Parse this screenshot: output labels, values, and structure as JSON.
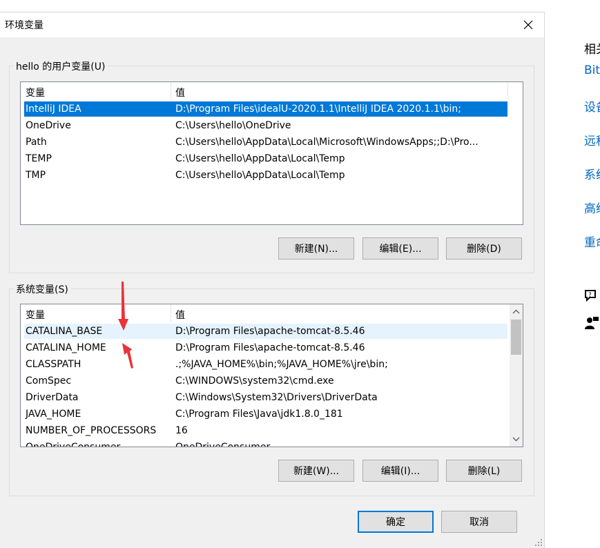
{
  "dialog": {
    "title": "环境变量",
    "close_label": "✕"
  },
  "user_vars": {
    "group_label": "hello 的用户变量(U)",
    "columns": [
      "变量",
      "值"
    ],
    "rows": [
      {
        "name": "IntelliJ IDEA",
        "value": "D:\\Program Files\\idealU-2020.1.1\\IntelliJ IDEA 2020.1.1\\bin;"
      },
      {
        "name": "OneDrive",
        "value": "C:\\Users\\hello\\OneDrive"
      },
      {
        "name": "Path",
        "value": "C:\\Users\\hello\\AppData\\Local\\Microsoft\\WindowsApps;;D:\\Pro..."
      },
      {
        "name": "TEMP",
        "value": "C:\\Users\\hello\\AppData\\Local\\Temp"
      },
      {
        "name": "TMP",
        "value": "C:\\Users\\hello\\AppData\\Local\\Temp"
      }
    ],
    "selected_index": 0,
    "buttons": {
      "new": "新建(N)...",
      "edit": "编辑(E)...",
      "delete": "删除(D)"
    }
  },
  "system_vars": {
    "group_label": "系统变量(S)",
    "columns": [
      "变量",
      "值"
    ],
    "rows": [
      {
        "name": "CATALINA_BASE",
        "value": "D:\\Program Files\\apache-tomcat-8.5.46"
      },
      {
        "name": "CATALINA_HOME",
        "value": "D:\\Program Files\\apache-tomcat-8.5.46"
      },
      {
        "name": "CLASSPATH",
        "value": ".;%JAVA_HOME%\\bin;%JAVA_HOME%\\jre\\bin;"
      },
      {
        "name": "ComSpec",
        "value": "C:\\WINDOWS\\system32\\cmd.exe"
      },
      {
        "name": "DriverData",
        "value": "C:\\Windows\\System32\\Drivers\\DriverData"
      },
      {
        "name": "JAVA_HOME",
        "value": "C:\\Program Files\\Java\\jdk1.8.0_181"
      },
      {
        "name": "NUMBER_OF_PROCESSORS",
        "value": "16"
      },
      {
        "name": "OneDriveConsumer",
        "value": "OneDriveConsumer"
      }
    ],
    "hover_index": 0,
    "buttons": {
      "new": "新建(W)...",
      "edit": "编辑(I)...",
      "delete": "删除(L)"
    }
  },
  "footer": {
    "ok": "确定",
    "cancel": "取消"
  },
  "right_panel": {
    "heading": "相关",
    "links": [
      "BitLocker",
      "设备",
      "远程",
      "系统",
      "高级",
      "重命名"
    ]
  },
  "colors": {
    "accent": "#0078d7",
    "annotation_arrow": "#e8343a",
    "link": "#0067c0"
  }
}
